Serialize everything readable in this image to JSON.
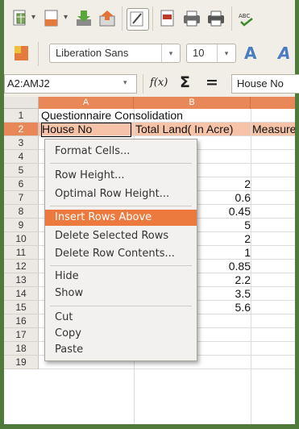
{
  "toolbar_standard": {
    "icons": [
      "new-document-icon",
      "template-icon",
      "download-icon",
      "export-icon",
      "edit-mode-icon",
      "pdf-export-icon",
      "print-icon",
      "print-preview-icon",
      "spellcheck-icon"
    ],
    "caret": "▾"
  },
  "toolbar_format": {
    "font_name": "Liberation Sans",
    "font_size": "10",
    "bold_glyph": "A",
    "italic_glyph": "A"
  },
  "formula_bar": {
    "name_box": "A2:AMJ2",
    "fx_label": "f(x)",
    "sum_label": "Σ",
    "equals_label": "=",
    "input_value": "House No"
  },
  "columns": [
    "A",
    "B"
  ],
  "rows": [
    "1",
    "2",
    "3",
    "4",
    "5",
    "6",
    "7",
    "8",
    "9",
    "10",
    "11",
    "12",
    "13",
    "14",
    "15",
    "16",
    "17",
    "18",
    "19"
  ],
  "cells": {
    "a1": "Questionnaire Consolidation",
    "a2": "House No",
    "b2": "Total Land( In Acre)",
    "c2": "Measure",
    "b_values": [
      "2",
      "0.6",
      "0.45",
      "5",
      "2",
      "1",
      "0.85",
      "2.2",
      "3.5",
      "5.6"
    ]
  },
  "context_menu": {
    "items": [
      {
        "label": "Format Cells...",
        "highlighted": false
      },
      {
        "label": "Row Height...",
        "highlighted": false
      },
      {
        "label": "Optimal Row Height...",
        "highlighted": false
      },
      {
        "label": "Insert Rows Above",
        "highlighted": true
      },
      {
        "label": "Delete Selected Rows",
        "highlighted": false
      },
      {
        "label": "Delete Row Contents...",
        "highlighted": false
      },
      {
        "label": "Hide",
        "highlighted": false
      },
      {
        "label": "Show",
        "highlighted": false
      },
      {
        "label": "Cut",
        "highlighted": false
      },
      {
        "label": "Copy",
        "highlighted": false
      },
      {
        "label": "Paste",
        "highlighted": false
      }
    ]
  },
  "colors": {
    "accent": "#e88858",
    "menu_highlight": "#ec7a3f",
    "frame": "#4f7a3b"
  }
}
